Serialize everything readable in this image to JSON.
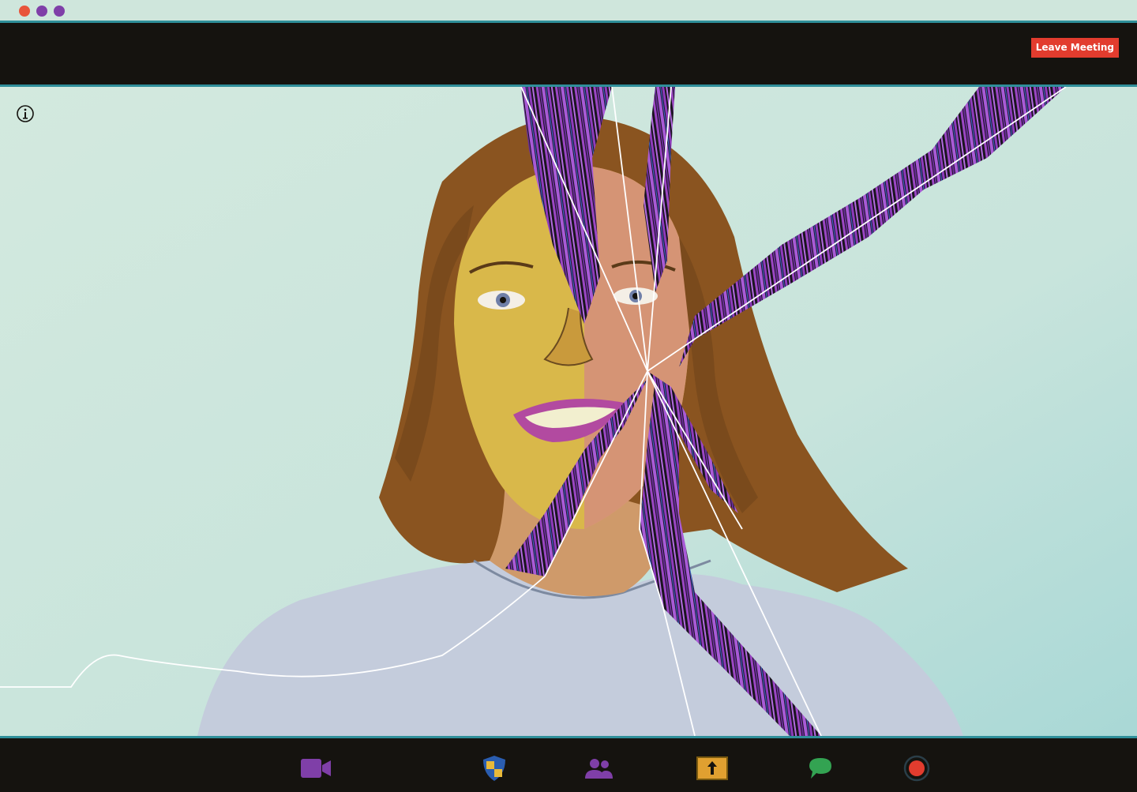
{
  "window": {
    "traffic_lights": [
      "#e8543a",
      "#7f3fa8",
      "#7f3fa8"
    ]
  },
  "header": {
    "leave_button_label": "Leave Meeting",
    "leave_button_color": "#e23c2e"
  },
  "stage": {
    "info_icon": "info-icon"
  },
  "toolbar": {
    "controls": [
      {
        "icon": "video-camera-icon",
        "color": "#7f3fa8"
      },
      {
        "icon": "security-shield-icon",
        "color": "#2a5db0"
      },
      {
        "icon": "participants-icon",
        "color": "#7f3fa8"
      },
      {
        "icon": "share-screen-icon",
        "color": "#e0a030"
      },
      {
        "icon": "chat-icon",
        "color": "#33a352"
      },
      {
        "icon": "record-icon",
        "color": "#e23c2e"
      }
    ]
  }
}
